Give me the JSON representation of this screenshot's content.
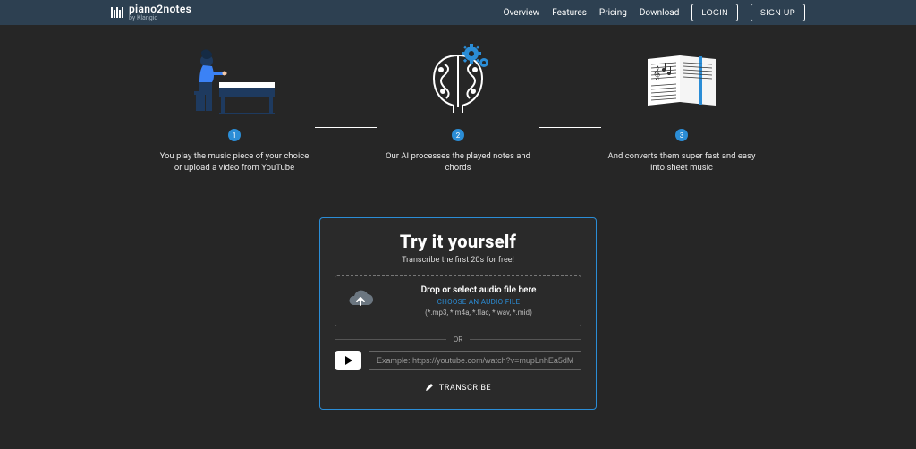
{
  "header": {
    "brand_title": "piano2notes",
    "brand_sub": "by Klangio",
    "nav": {
      "overview": "Overview",
      "features": "Features",
      "pricing": "Pricing",
      "download": "Download",
      "login": "LOGIN",
      "signup": "SIGN UP"
    }
  },
  "steps": {
    "s1": {
      "num": "1",
      "text": "You play the music piece of your choice or upload a video from YouTube"
    },
    "s2": {
      "num": "2",
      "text": "Our AI processes the played notes and chords"
    },
    "s3": {
      "num": "3",
      "text": "And converts them super fast and easy into sheet music"
    }
  },
  "try": {
    "title": "Try it yourself",
    "subtitle": "Transcribe the first 20s for free!",
    "drop_title": "Drop or select audio file here",
    "choose": "CHOOSE AN AUDIO FILE",
    "formats": "(*.mp3, *.m4a, *.flac, *.wav, *.mid)",
    "or": "OR",
    "yt_placeholder": "Example: https://youtube.com/watch?v=mupLnhEa5dM",
    "transcribe": "TRANSCRIBE"
  }
}
